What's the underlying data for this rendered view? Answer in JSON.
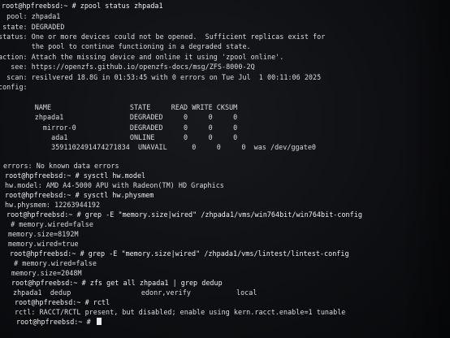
{
  "terminal": {
    "lines": [
      "root@hpfreebsd:~ # zpool status zhpada1",
      "  pool: zhpada1",
      " state: DEGRADED",
      "status: One or more devices could not be opened.  Sufficient replicas exist for",
      "        the pool to continue functioning in a degraded state.",
      "action: Attach the missing device and online it using 'zpool online'.",
      "   see: https://openzfs.github.io/openzfs-docs/msg/ZFS-8000-2Q",
      "  scan: resilvered 18.8G in 01:53:45 with 0 errors on Tue Jul  1 00:11:06 2025",
      "config:",
      "",
      "        NAME                   STATE     READ WRITE CKSUM",
      "        zhpada1                DEGRADED     0     0     0",
      "          mirror-0             DEGRADED     0     0     0",
      "            ada1               ONLINE       0     0     0",
      "            3591102491474271834  UNAVAIL      0     0     0  was /dev/ggate0",
      "",
      "errors: No known data errors",
      "root@hpfreebsd:~ # sysctl hw.model",
      "hw.model: AMD A4-5000 APU with Radeon(TM) HD Graphics",
      "root@hpfreebsd:~ # sysctl hw.physmem",
      "hw.physmem: 12263944192",
      "root@hpfreebsd:~ # grep -E \"memory.size|wired\" /zhpada1/vms/win764bit/win764bit-config",
      " # memory.wired=false",
      "memory.size=8192M",
      "memory.wired=true",
      "root@hpfreebsd:~ # grep -E \"memory.size|wired\" /zhpada1/vms/lintest/lintest-config",
      " # memory.wired=false",
      "memory.size=2048M",
      "root@hpfreebsd:~ # zfs get all zhpada1 | grep dedup",
      "zhpada1  dedup                 edonr,verify           local",
      "root@hpfreebsd:~ # rctl",
      "rctl: RACCT/RCTL present, but disabled; enable using kern.racct.enable=1 tunable",
      "root@hpfreebsd:~ # "
    ]
  }
}
